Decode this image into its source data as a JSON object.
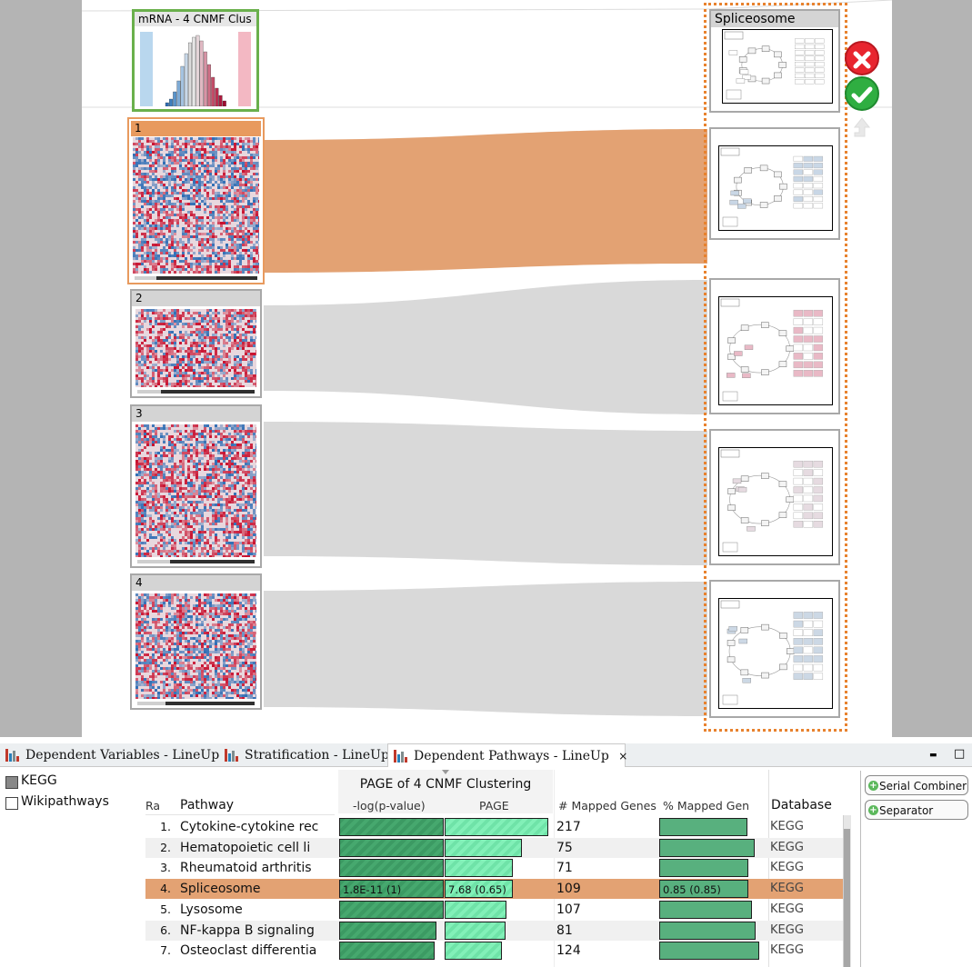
{
  "canvas": {
    "cluster_panel_title": "mRNA - 4 CNMF Clus",
    "clusters": [
      {
        "label": "1",
        "selected": true
      },
      {
        "label": "2",
        "selected": false
      },
      {
        "label": "3",
        "selected": false
      },
      {
        "label": "4",
        "selected": false
      }
    ],
    "pathway_panel_title": "Spliceosome",
    "colors": {
      "selection": "#e89a5e",
      "flow_gray": "#d9d9d9",
      "cluster_frame": "#6ab04c",
      "heat_red": "#c8102e",
      "heat_blue": "#2f6eb5"
    },
    "actions": {
      "cancel_icon": "close-circle-icon",
      "confirm_icon": "check-circle-icon",
      "extra_icon": "arrow-up-icon"
    }
  },
  "tabs": [
    {
      "label": "Dependent Variables - LineUp",
      "active": false
    },
    {
      "label": "Stratification - LineUp",
      "active": false
    },
    {
      "label": "Dependent Pathways - LineUp",
      "active": true,
      "close": "×"
    }
  ],
  "window_buttons": {
    "minimize": "▬",
    "maximize": "□"
  },
  "filters": [
    {
      "label": "KEGG",
      "checked": true
    },
    {
      "label": "Wikipathways",
      "checked": false
    }
  ],
  "table": {
    "group_header": "PAGE of 4 CNMF Clustering",
    "columns": {
      "rank": "Ra",
      "pathway": "Pathway",
      "neg_log_p": "-log(p-value)",
      "page": "PAGE",
      "mapped_genes": "# Mapped Genes",
      "pct_mapped": "% Mapped Gen",
      "database": "Database"
    },
    "rows": [
      {
        "rank": "1.",
        "pathway": "Cytokine-cytokine rec",
        "neg_log_p_frac": 1.0,
        "page_frac": 0.99,
        "mapped_genes": "217",
        "pct_frac": 0.88,
        "database": "KEGG"
      },
      {
        "rank": "2.",
        "pathway": "Hematopoietic cell li",
        "neg_log_p_frac": 1.0,
        "page_frac": 0.74,
        "mapped_genes": "75",
        "pct_frac": 0.95,
        "database": "KEGG"
      },
      {
        "rank": "3.",
        "pathway": "Rheumatoid arthritis",
        "neg_log_p_frac": 1.0,
        "page_frac": 0.65,
        "mapped_genes": "71",
        "pct_frac": 0.89,
        "database": "KEGG"
      },
      {
        "rank": "4.",
        "pathway": "Spliceosome",
        "neg_log_p_frac": 1.0,
        "page_frac": 0.65,
        "mapped_genes": "109",
        "pct_frac": 0.89,
        "database": "KEGG",
        "selected": true,
        "neg_log_p_label": "1.8E-11 (1)",
        "page_label": "7.68 (0.65)",
        "pct_label": "0.85 (0.85)"
      },
      {
        "rank": "5.",
        "pathway": "Lysosome",
        "neg_log_p_frac": 1.0,
        "page_frac": 0.59,
        "mapped_genes": "107",
        "pct_frac": 0.93,
        "database": "KEGG"
      },
      {
        "rank": "6.",
        "pathway": "NF-kappa B signaling",
        "neg_log_p_frac": 0.93,
        "page_frac": 0.58,
        "mapped_genes": "81",
        "pct_frac": 0.96,
        "database": "KEGG"
      },
      {
        "rank": "7.",
        "pathway": "Osteoclast differentia",
        "neg_log_p_frac": 0.91,
        "page_frac": 0.55,
        "mapped_genes": "124",
        "pct_frac": 1.0,
        "database": "KEGG"
      }
    ]
  },
  "combiners": [
    {
      "label": "Serial Combiner"
    },
    {
      "label": "Separator"
    }
  ]
}
